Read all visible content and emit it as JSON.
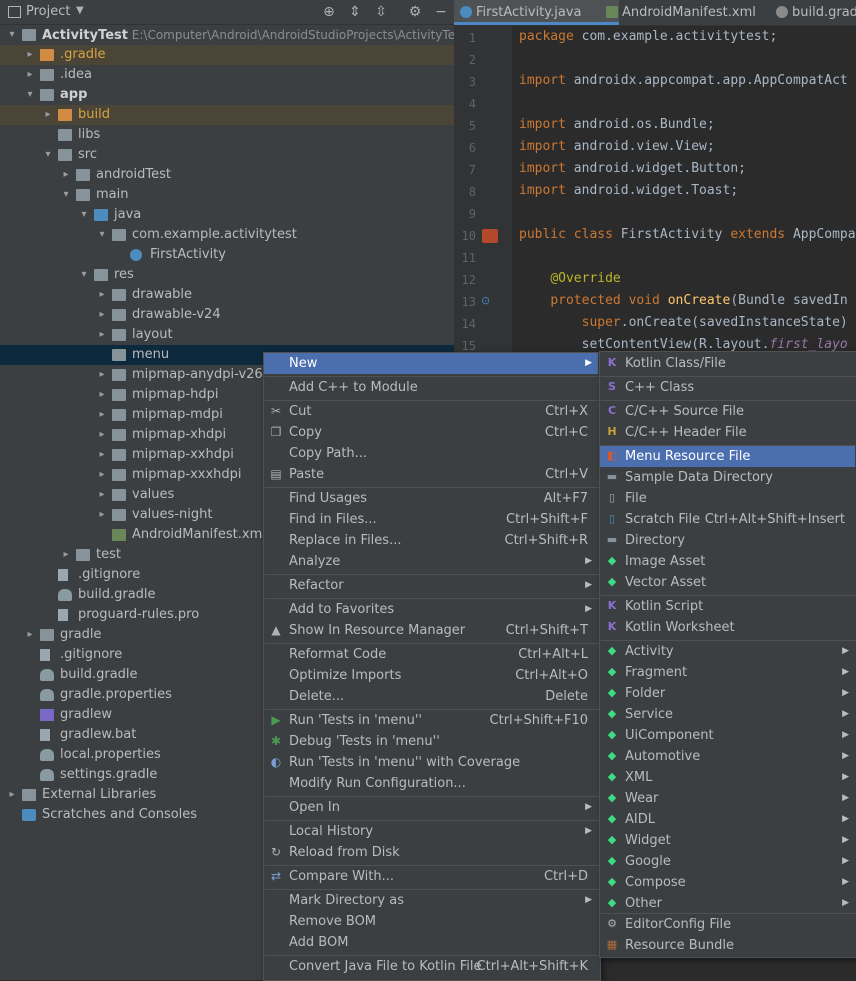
{
  "toolbar": {
    "project_label": "Project",
    "icons": [
      "target-icon",
      "expand-all-icon",
      "collapse-all-icon",
      "settings-icon",
      "minimize-icon"
    ]
  },
  "tree": [
    {
      "label": "ActivityTest",
      "extra": "E:\\Computer\\Android\\AndroidStudioProjects\\ActivityTest",
      "bold": true
    },
    {
      "label": ".gradle"
    },
    {
      "label": ".idea"
    },
    {
      "label": "app",
      "bold": true
    },
    {
      "label": "build"
    },
    {
      "label": "libs"
    },
    {
      "label": "src"
    },
    {
      "label": "androidTest"
    },
    {
      "label": "main"
    },
    {
      "label": "java"
    },
    {
      "label": "com.example.activitytest"
    },
    {
      "label": "FirstActivity"
    },
    {
      "label": "res"
    },
    {
      "label": "drawable"
    },
    {
      "label": "drawable-v24"
    },
    {
      "label": "layout"
    },
    {
      "label": "menu"
    },
    {
      "label": "mipmap-anydpi-v26"
    },
    {
      "label": "mipmap-hdpi"
    },
    {
      "label": "mipmap-mdpi"
    },
    {
      "label": "mipmap-xhdpi"
    },
    {
      "label": "mipmap-xxhdpi"
    },
    {
      "label": "mipmap-xxxhdpi"
    },
    {
      "label": "values"
    },
    {
      "label": "values-night"
    },
    {
      "label": "AndroidManifest.xml"
    },
    {
      "label": "test"
    },
    {
      "label": ".gitignore"
    },
    {
      "label": "build.gradle"
    },
    {
      "label": "proguard-rules.pro"
    },
    {
      "label": "gradle"
    },
    {
      "label": ".gitignore"
    },
    {
      "label": "build.gradle"
    },
    {
      "label": "gradle.properties"
    },
    {
      "label": "gradlew"
    },
    {
      "label": "gradlew.bat"
    },
    {
      "label": "local.properties"
    },
    {
      "label": "settings.gradle"
    },
    {
      "label": "External Libraries"
    },
    {
      "label": "Scratches and Consoles"
    }
  ],
  "tabs": [
    "FirstActivity.java",
    "AndroidManifest.xml",
    "build.gradl"
  ],
  "line_numbers": [
    "1",
    "2",
    "3",
    "4",
    "5",
    "6",
    "7",
    "8",
    "9",
    "10",
    "11",
    "12",
    "13",
    "14",
    "15"
  ],
  "code": {
    "l1_kw": "package",
    "l1": " com.example.activitytest;",
    "l3_kw": "import",
    "l3": " androidx.appcompat.app.AppCompatAct",
    "l5_kw": "import",
    "l5": " android.os.Bundle;",
    "l6_kw": "import",
    "l6": " android.view.View;",
    "l7_kw": "import",
    "l7": " android.widget.Button;",
    "l8_kw": "import",
    "l8": " android.widget.Toast;",
    "l10_kw1": "public class",
    "l10_a": " FirstActivity ",
    "l10_kw2": "extends",
    "l10_b": " AppCompa",
    "l12": "@Override",
    "l13_kw": "protected void",
    "l13_fn": " onCreate",
    "l13_b": "(Bundle savedIn",
    "l14_kw": "super",
    "l14_b": ".onCreate(savedInstanceState)",
    "l15_a": "setContentView(R.layout.",
    "l15_it": "first_layo"
  },
  "context_menu": [
    {
      "label": "New",
      "submenu": true,
      "highlight": true
    },
    {
      "label": "Add C++ to Module"
    },
    {
      "label": "Cut",
      "shortcut": "Ctrl+X",
      "icon": "cut-icon"
    },
    {
      "label": "Copy",
      "shortcut": "Ctrl+C",
      "icon": "copy-icon"
    },
    {
      "label": "Copy Path..."
    },
    {
      "label": "Paste",
      "shortcut": "Ctrl+V",
      "icon": "paste-icon"
    },
    {
      "label": "Find Usages",
      "shortcut": "Alt+F7"
    },
    {
      "label": "Find in Files...",
      "shortcut": "Ctrl+Shift+F"
    },
    {
      "label": "Replace in Files...",
      "shortcut": "Ctrl+Shift+R"
    },
    {
      "label": "Analyze",
      "submenu": true
    },
    {
      "label": "Refactor",
      "submenu": true
    },
    {
      "label": "Add to Favorites",
      "submenu": true
    },
    {
      "label": "Show In Resource Manager",
      "shortcut": "Ctrl+Shift+T",
      "icon": "resource-manager-icon"
    },
    {
      "label": "Reformat Code",
      "shortcut": "Ctrl+Alt+L"
    },
    {
      "label": "Optimize Imports",
      "shortcut": "Ctrl+Alt+O"
    },
    {
      "label": "Delete...",
      "shortcut": "Delete"
    },
    {
      "label": "Run 'Tests in 'menu''",
      "shortcut": "Ctrl+Shift+F10",
      "icon": "run-icon"
    },
    {
      "label": "Debug 'Tests in 'menu''",
      "icon": "debug-icon"
    },
    {
      "label": "Run 'Tests in 'menu'' with Coverage",
      "icon": "coverage-icon"
    },
    {
      "label": "Modify Run Configuration..."
    },
    {
      "label": "Open In",
      "submenu": true
    },
    {
      "label": "Local History",
      "submenu": true
    },
    {
      "label": "Reload from Disk",
      "icon": "reload-icon"
    },
    {
      "label": "Compare With...",
      "shortcut": "Ctrl+D",
      "icon": "compare-icon"
    },
    {
      "label": "Mark Directory as",
      "submenu": true
    },
    {
      "label": "Remove BOM"
    },
    {
      "label": "Add BOM"
    },
    {
      "label": "Convert Java File to Kotlin File",
      "shortcut": "Ctrl+Alt+Shift+K"
    }
  ],
  "new_submenu": [
    {
      "label": "Kotlin Class/File",
      "icon": "kotlin-icon"
    },
    {
      "label": "C++ Class",
      "icon": "cpp-class-icon"
    },
    {
      "label": "C/C++ Source File",
      "icon": "cpp-source-icon"
    },
    {
      "label": "C/C++ Header File",
      "icon": "cpp-header-icon"
    },
    {
      "label": "Menu Resource File",
      "icon": "menu-resource-icon",
      "highlight": true
    },
    {
      "label": "Sample Data Directory",
      "icon": "folder-icon"
    },
    {
      "label": "File",
      "icon": "file-icon"
    },
    {
      "label": "Scratch File",
      "shortcut": "Ctrl+Alt+Shift+Insert",
      "icon": "scratch-icon"
    },
    {
      "label": "Directory",
      "icon": "folder-icon"
    },
    {
      "label": "Image Asset",
      "icon": "android-icon"
    },
    {
      "label": "Vector Asset",
      "icon": "android-icon"
    },
    {
      "label": "Kotlin Script",
      "icon": "kotlin-icon"
    },
    {
      "label": "Kotlin Worksheet",
      "icon": "kotlin-icon"
    },
    {
      "label": "Activity",
      "submenu": true,
      "icon": "android-icon"
    },
    {
      "label": "Fragment",
      "submenu": true,
      "icon": "android-icon"
    },
    {
      "label": "Folder",
      "submenu": true,
      "icon": "android-icon"
    },
    {
      "label": "Service",
      "submenu": true,
      "icon": "android-icon"
    },
    {
      "label": "UiComponent",
      "submenu": true,
      "icon": "android-icon"
    },
    {
      "label": "Automotive",
      "submenu": true,
      "icon": "android-icon"
    },
    {
      "label": "XML",
      "submenu": true,
      "icon": "android-icon"
    },
    {
      "label": "Wear",
      "submenu": true,
      "icon": "android-icon"
    },
    {
      "label": "AIDL",
      "submenu": true,
      "icon": "android-icon"
    },
    {
      "label": "Widget",
      "submenu": true,
      "icon": "android-icon"
    },
    {
      "label": "Google",
      "submenu": true,
      "icon": "android-icon"
    },
    {
      "label": "Compose",
      "submenu": true,
      "icon": "android-icon"
    },
    {
      "label": "Other",
      "submenu": true,
      "icon": "android-icon"
    },
    {
      "label": "EditorConfig File",
      "icon": "gear-icon"
    },
    {
      "label": "Resource Bundle",
      "icon": "bundle-icon"
    }
  ],
  "colors": {
    "highlight": "#4b6eaf",
    "selected_row": "#0d293e",
    "keyword": "#cc7832"
  }
}
